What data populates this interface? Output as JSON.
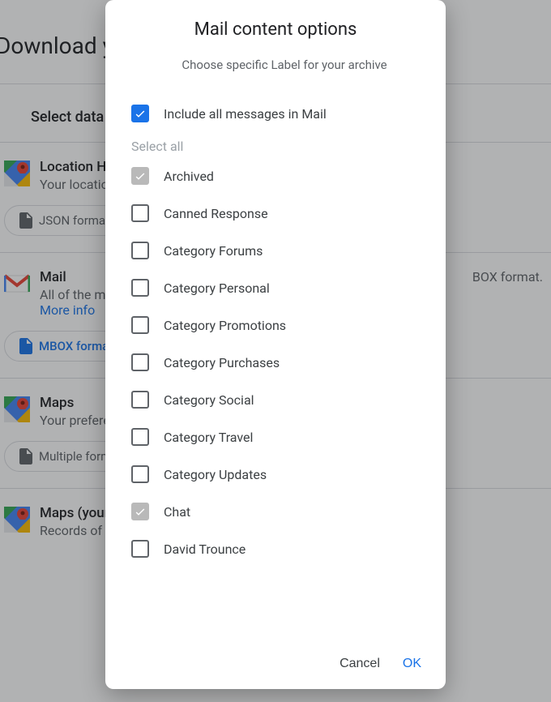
{
  "background": {
    "header": "Download yo",
    "section_title": "Select data",
    "rows": [
      {
        "title": "Location His",
        "sub": "Your location",
        "pill": "JSON forma",
        "pill_blue": false,
        "icon": "maps"
      },
      {
        "title": "Mail",
        "sub": "All of the me",
        "link": "More info",
        "right": "BOX format.",
        "pill": "MBOX forma",
        "pill_blue": true,
        "icon": "mail"
      },
      {
        "title": "Maps",
        "sub": "Your preferen",
        "pill": "Multiple form",
        "pill_blue": false,
        "icon": "maps"
      },
      {
        "title": "Maps (your p",
        "sub": "Records of y",
        "icon": "maps"
      }
    ]
  },
  "dialog": {
    "title": "Mail content options",
    "subtitle": "Choose specific Label for your archive",
    "include_all_label": "Include all messages in Mail",
    "select_all_label": "Select all",
    "items": [
      {
        "label": "Archived",
        "checked": true,
        "disabled": true
      },
      {
        "label": "Canned Response",
        "checked": false,
        "disabled": false
      },
      {
        "label": "Category Forums",
        "checked": false,
        "disabled": false
      },
      {
        "label": "Category Personal",
        "checked": false,
        "disabled": false
      },
      {
        "label": "Category Promotions",
        "checked": false,
        "disabled": false
      },
      {
        "label": "Category Purchases",
        "checked": false,
        "disabled": false
      },
      {
        "label": "Category Social",
        "checked": false,
        "disabled": false
      },
      {
        "label": "Category Travel",
        "checked": false,
        "disabled": false
      },
      {
        "label": "Category Updates",
        "checked": false,
        "disabled": false
      },
      {
        "label": "Chat",
        "checked": true,
        "disabled": true
      },
      {
        "label": "David Trounce",
        "checked": false,
        "disabled": false
      }
    ],
    "cancel": "Cancel",
    "ok": "OK"
  }
}
